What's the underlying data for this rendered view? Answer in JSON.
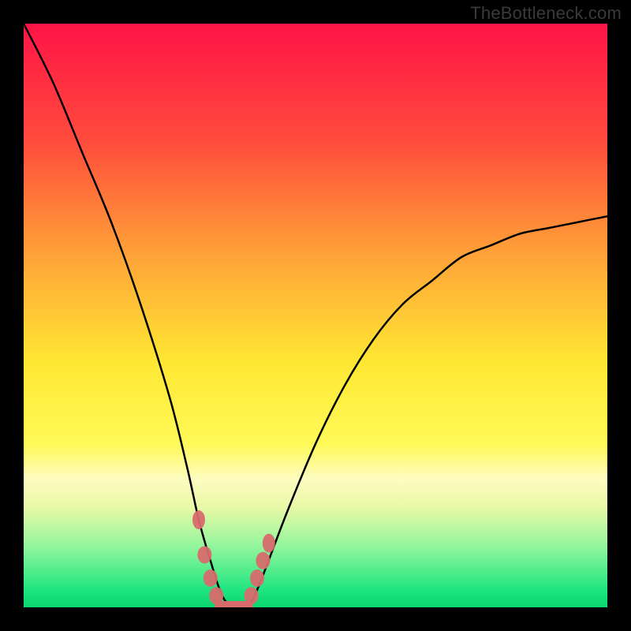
{
  "watermark": "TheBottleneck.com",
  "chart_data": {
    "type": "line",
    "title": "",
    "xlabel": "",
    "ylabel": "",
    "xlim": [
      0,
      100
    ],
    "ylim": [
      0,
      100
    ],
    "grid": false,
    "legend": false,
    "background_gradient_stops": [
      {
        "pct": 0,
        "color": "#ff1447"
      },
      {
        "pct": 20,
        "color": "#ff4b3c"
      },
      {
        "pct": 40,
        "color": "#ffa438"
      },
      {
        "pct": 58,
        "color": "#ffe733"
      },
      {
        "pct": 72,
        "color": "#fffa58"
      },
      {
        "pct": 78,
        "color": "#fdfcc0"
      },
      {
        "pct": 83,
        "color": "#e7f9a6"
      },
      {
        "pct": 90,
        "color": "#8cf59b"
      },
      {
        "pct": 97,
        "color": "#1fe57f"
      },
      {
        "pct": 100,
        "color": "#09d56f"
      }
    ],
    "series": [
      {
        "name": "bottleneck-curve",
        "color": "#000000",
        "x": [
          0,
          5,
          10,
          15,
          20,
          25,
          28,
          30,
          32,
          34,
          36,
          38,
          40,
          45,
          50,
          55,
          60,
          65,
          70,
          75,
          80,
          85,
          90,
          95,
          100
        ],
        "values": [
          100,
          90,
          78,
          66,
          52,
          36,
          24,
          15,
          8,
          2,
          0,
          0,
          3,
          16,
          28,
          38,
          46,
          52,
          56,
          60,
          62,
          64,
          65,
          66,
          67
        ]
      }
    ],
    "markers": {
      "name": "trough-markers",
      "color": "#d76b6b",
      "style": "blob",
      "points": [
        {
          "x": 30,
          "y": 15
        },
        {
          "x": 31,
          "y": 9
        },
        {
          "x": 32,
          "y": 5
        },
        {
          "x": 33,
          "y": 2
        },
        {
          "x": 34,
          "y": 0
        },
        {
          "x": 35,
          "y": 0
        },
        {
          "x": 36,
          "y": 0
        },
        {
          "x": 37,
          "y": 0
        },
        {
          "x": 38,
          "y": 0
        },
        {
          "x": 39,
          "y": 2
        },
        {
          "x": 40,
          "y": 5
        },
        {
          "x": 41,
          "y": 8
        },
        {
          "x": 42,
          "y": 11
        }
      ]
    }
  }
}
